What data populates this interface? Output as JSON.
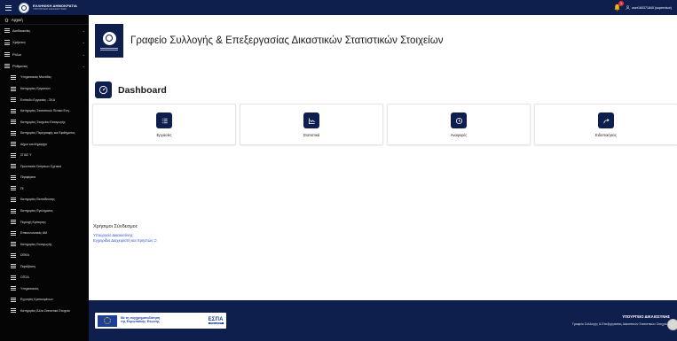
{
  "topbar": {
    "brand_line1": "ΕΛΛΗΝΙΚΗ ΔΗΜΟΚΡΑΤΙΑ",
    "brand_line2": "ΥΠΟΥΡΓΕΙΟ ΔΙΚΑΙΟΣΥΝΗΣ",
    "notification_count": "1",
    "user_label": "user160371840 (supervisor)"
  },
  "sidebar": {
    "home_label": "Αρχική",
    "groups": [
      {
        "label": "Διαδικασίες",
        "icon": "list-icon"
      },
      {
        "label": "Χρήστες",
        "icon": "list-icon"
      },
      {
        "label": "Ρόλοι",
        "icon": "list-icon"
      },
      {
        "label": "Ρύθμισεις",
        "icon": "list-icon"
      }
    ],
    "items": [
      {
        "label": "Υπηρεσιακές Μονάδες"
      },
      {
        "label": "Κατηγορίες Εργασιών"
      },
      {
        "label": "Επίπεδο Εργασίας - ΣΚΑ"
      },
      {
        "label": "Κατηγορίες Στατιστικού Πίνακα Ενη.."
      },
      {
        "label": "Κατηγορίες Στοιχείου Εισαγωγής"
      },
      {
        "label": "Κατηγορίες Περιγραφής και Εφιθήματος"
      },
      {
        "label": "Δήμοι και Δήμαρχοι"
      },
      {
        "label": "ΣΠΑΣ Υ"
      },
      {
        "label": "Προστασία Οιτήσεων Σχετικοί"
      },
      {
        "label": "Περιφέρεια"
      },
      {
        "label": "ΠΙ"
      },
      {
        "label": "Κατηγορίες Εκπαίδευσης"
      },
      {
        "label": "Κατηγορίες Εγκλήματος"
      },
      {
        "label": "Περιοχή Κράτησης"
      },
      {
        "label": "Επικοινωνιακές ΑΜ"
      },
      {
        "label": "Κατηγορίες Εισαγωγής"
      },
      {
        "label": "ΩΠΚΑ"
      },
      {
        "label": "Παράβαση"
      },
      {
        "label": "ΟΠΣΑ"
      },
      {
        "label": "Υπηρεσιακός"
      },
      {
        "label": "Εγγυητές Κρατουμένων"
      },
      {
        "label": "Κατηγορίες Άλλα Στατιστικά Στοιχεία"
      }
    ]
  },
  "main": {
    "org_title": "Γραφείο Συλλογής & Επεξεργασίας Δικαστικών Στατιστικών Στοιχείων",
    "dashboard_title": "Dashboard",
    "cards": [
      {
        "label": "Εργασίες",
        "icon": "list-icon"
      },
      {
        "label": "Στατιστικά",
        "icon": "chart-icon"
      },
      {
        "label": "Αναφορές",
        "icon": "clock-icon"
      },
      {
        "label": "Ειδοποιήσεις",
        "icon": "share-icon"
      }
    ],
    "links_title": "Χρήσιμοι Σύνδεσμοι:",
    "links": [
      {
        "label": "Υπουργείο Δικαιοσύνης"
      },
      {
        "label": "Εγχειρίδιο Διαχειριστή και Χρηστών"
      }
    ]
  },
  "footer": {
    "espa_line1": "Με τη συγχρηματοδότηση",
    "espa_line2": "της Ευρωπαϊκής Ένωσης",
    "espa_logo": "ΕΣΠΑ",
    "espa_years": "2021-2027",
    "ministry": "ΥΠΟΥΡΓΕΙΟ ΔΙΚΑΙΟΣΥΝΗΣ",
    "office": "Γραφείο Συλλογής & Επεξεργασίας Δικαστικών Στατιστικών Στοιχείων"
  },
  "colors": {
    "navy": "#0e1f4d",
    "sidebar_bg": "#050505",
    "link": "#2b50c8",
    "badge": "#e0303a"
  }
}
